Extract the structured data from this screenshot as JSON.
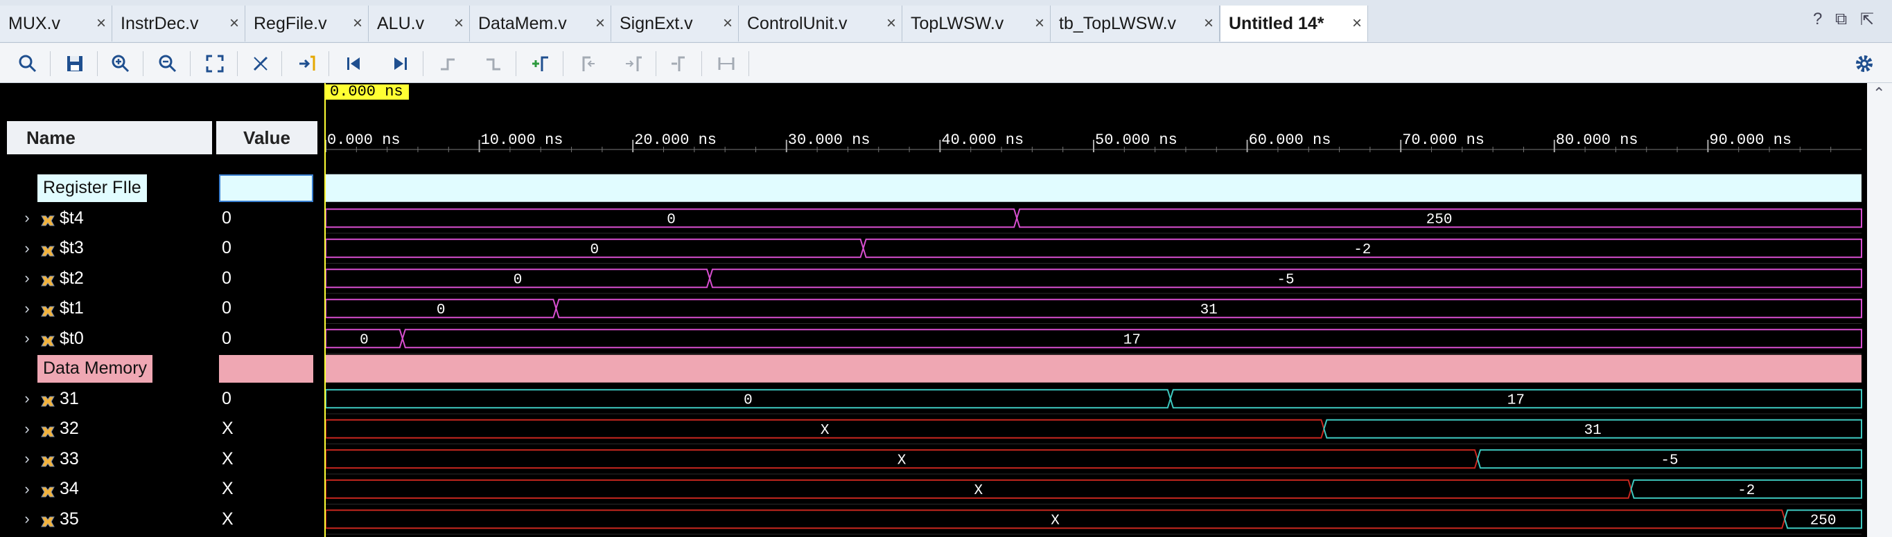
{
  "tabs": [
    {
      "label": "MUX.v",
      "active": false
    },
    {
      "label": "InstrDec.v",
      "active": false
    },
    {
      "label": "RegFile.v",
      "active": false
    },
    {
      "label": "ALU.v",
      "active": false
    },
    {
      "label": "DataMem.v",
      "active": false
    },
    {
      "label": "SignExt.v",
      "active": false
    },
    {
      "label": "ControlUnit.v",
      "active": false
    },
    {
      "label": "TopLWSW.v",
      "active": false
    },
    {
      "label": "tb_TopLWSW.v",
      "active": false
    },
    {
      "label": "Untitled 14*",
      "active": true
    }
  ],
  "window_controls": {
    "help": "?",
    "restore": "⧉",
    "float": "⇱"
  },
  "toolbar": {
    "icons": [
      "search-icon",
      "save-icon",
      "zoom-in-icon",
      "zoom-out-icon",
      "zoom-fit-icon",
      "cursor-snap-icon",
      "goto-cursor-icon",
      "go-first-icon",
      "go-last-icon",
      "prev-transition-icon",
      "next-transition-icon",
      "add-marker-icon",
      "prev-marker-icon",
      "next-marker-icon",
      "swap-cursors-icon",
      "marker-range-icon",
      "settings-gear-icon"
    ]
  },
  "waveform": {
    "name_header": "Name",
    "value_header": "Value",
    "cursor_time": "0.000 ns",
    "time_unit": "ns",
    "time_ticks": [
      "0.000 ns",
      "10.000 ns",
      "20.000 ns",
      "30.000 ns",
      "40.000 ns",
      "50.000 ns",
      "60.000 ns",
      "70.000 ns",
      "80.000 ns",
      "90.000 ns"
    ],
    "time_range": [
      0,
      100
    ],
    "colors": {
      "register_group": "#e1fcff",
      "memory_group": "#efa7b3",
      "valid_bus": "#d84fd0",
      "memory_bus": "#3ec9c0",
      "unknown_bus": "#c9271f",
      "cursor": "#ffff33"
    },
    "rows": [
      {
        "kind": "group",
        "name": "Register FIle",
        "color": "#e1fcff"
      },
      {
        "kind": "signal",
        "name": "$t4",
        "value": "0",
        "color": "#d84fd0",
        "segments": [
          {
            "start": 0,
            "end": 45,
            "label": "0"
          },
          {
            "start": 45,
            "end": 100,
            "label": "250"
          }
        ]
      },
      {
        "kind": "signal",
        "name": "$t3",
        "value": "0",
        "color": "#d84fd0",
        "segments": [
          {
            "start": 0,
            "end": 35,
            "label": "0"
          },
          {
            "start": 35,
            "end": 100,
            "label": "-2"
          }
        ]
      },
      {
        "kind": "signal",
        "name": "$t2",
        "value": "0",
        "color": "#d84fd0",
        "segments": [
          {
            "start": 0,
            "end": 25,
            "label": "0"
          },
          {
            "start": 25,
            "end": 100,
            "label": "-5"
          }
        ]
      },
      {
        "kind": "signal",
        "name": "$t1",
        "value": "0",
        "color": "#d84fd0",
        "segments": [
          {
            "start": 0,
            "end": 15,
            "label": "0"
          },
          {
            "start": 15,
            "end": 100,
            "label": "31"
          }
        ]
      },
      {
        "kind": "signal",
        "name": "$t0",
        "value": "0",
        "color": "#d84fd0",
        "segments": [
          {
            "start": 0,
            "end": 5,
            "label": "0"
          },
          {
            "start": 5,
            "end": 100,
            "label": "17"
          }
        ]
      },
      {
        "kind": "group",
        "name": "Data Memory",
        "color": "#efa7b3"
      },
      {
        "kind": "signal",
        "name": "31",
        "value": "0",
        "color": "#3ec9c0",
        "segments": [
          {
            "start": 0,
            "end": 55,
            "label": "0",
            "color": "#3ec9c0"
          },
          {
            "start": 55,
            "end": 100,
            "label": "17",
            "color": "#3ec9c0"
          }
        ]
      },
      {
        "kind": "signal",
        "name": "32",
        "value": "X",
        "segments": [
          {
            "start": 0,
            "end": 65,
            "label": "X",
            "color": "#c9271f"
          },
          {
            "start": 65,
            "end": 100,
            "label": "31",
            "color": "#3ec9c0"
          }
        ]
      },
      {
        "kind": "signal",
        "name": "33",
        "value": "X",
        "segments": [
          {
            "start": 0,
            "end": 75,
            "label": "X",
            "color": "#c9271f"
          },
          {
            "start": 75,
            "end": 100,
            "label": "-5",
            "color": "#3ec9c0"
          }
        ]
      },
      {
        "kind": "signal",
        "name": "34",
        "value": "X",
        "segments": [
          {
            "start": 0,
            "end": 85,
            "label": "X",
            "color": "#c9271f"
          },
          {
            "start": 85,
            "end": 100,
            "label": "-2",
            "color": "#3ec9c0"
          }
        ]
      },
      {
        "kind": "signal",
        "name": "35",
        "value": "X",
        "segments": [
          {
            "start": 0,
            "end": 95,
            "label": "X",
            "color": "#c9271f"
          },
          {
            "start": 95,
            "end": 100,
            "label": "250",
            "color": "#3ec9c0"
          }
        ]
      }
    ]
  }
}
